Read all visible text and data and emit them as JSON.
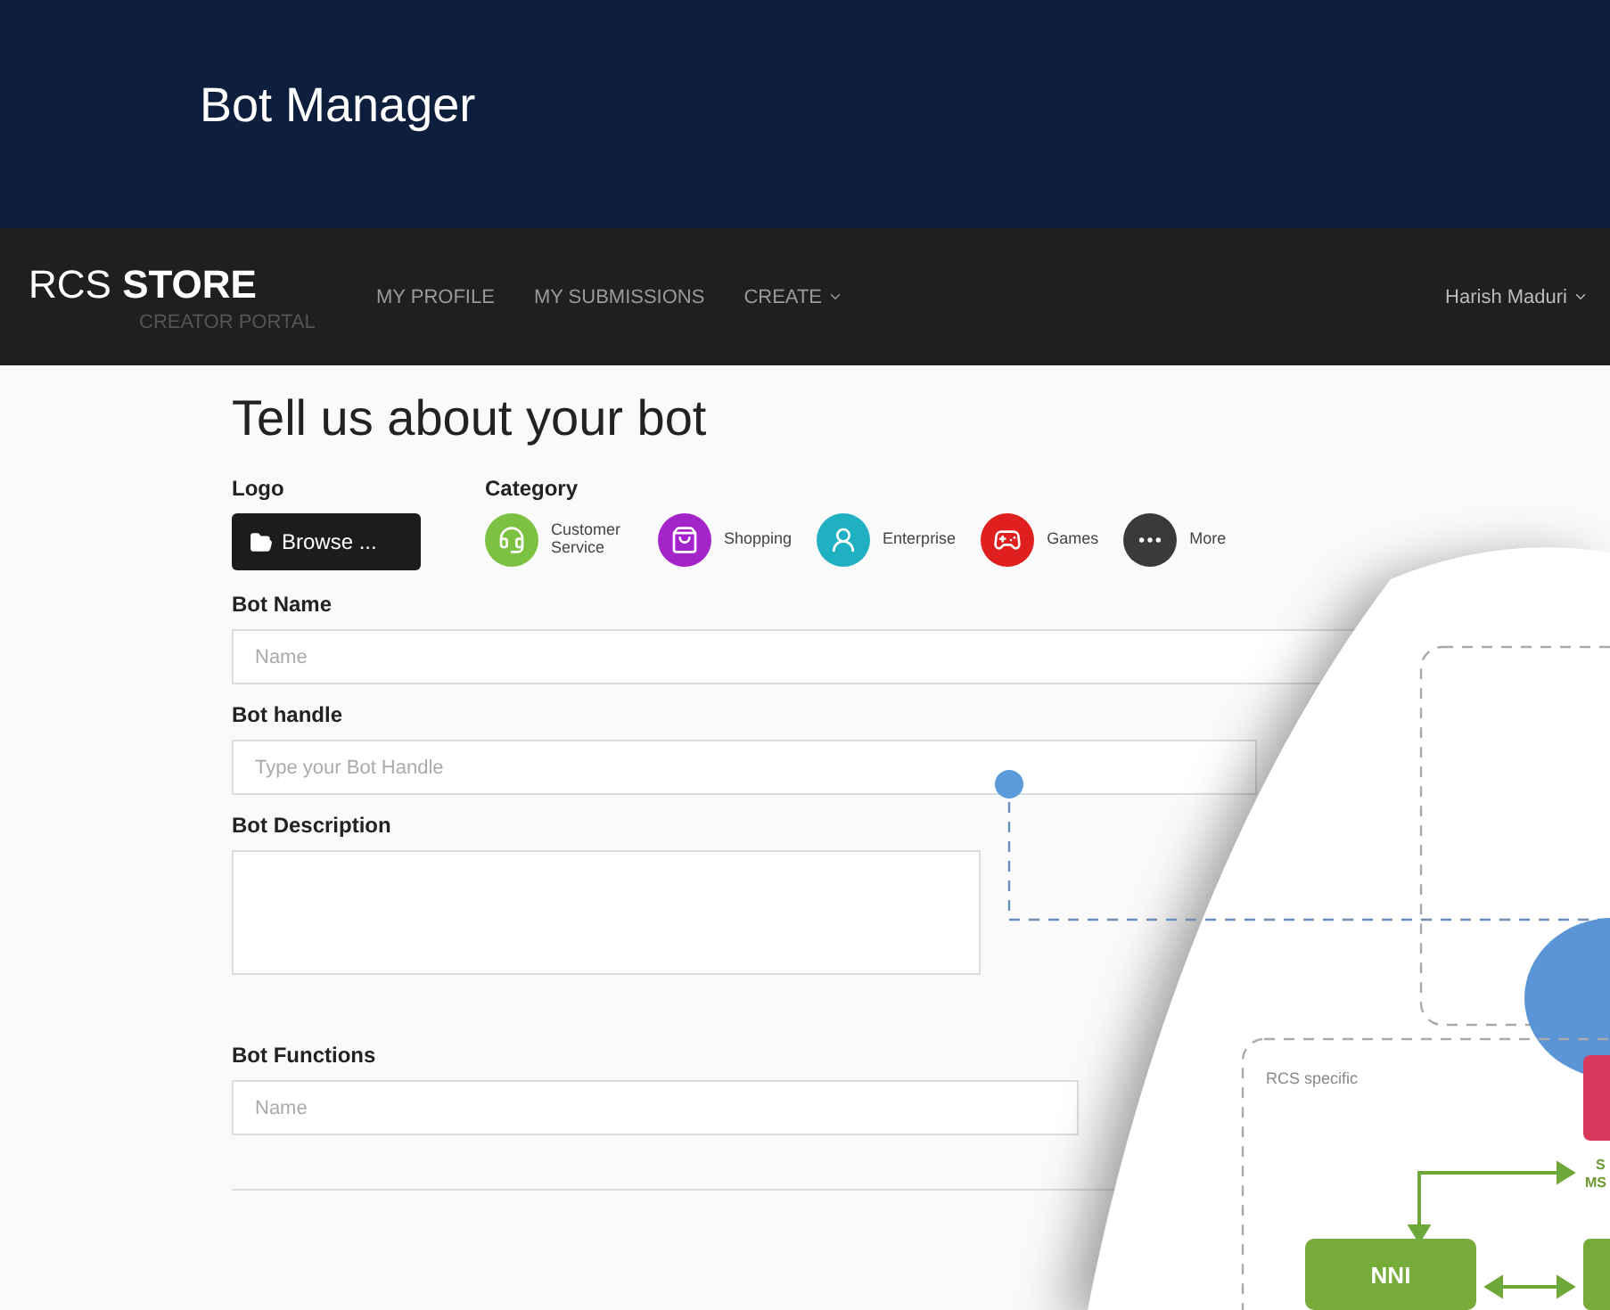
{
  "slide": {
    "title": "Bot Manager"
  },
  "navbar": {
    "brand": "RCS",
    "brand_bold": "STORE",
    "subtitle": "CREATOR PORTAL",
    "links": [
      {
        "label": "MY PROFILE",
        "dropdown": false
      },
      {
        "label": "MY SUBMISSIONS",
        "dropdown": false
      },
      {
        "label": "CREATE",
        "dropdown": true
      }
    ],
    "user": {
      "name": "Harish Maduri",
      "dropdown": true
    }
  },
  "form": {
    "heading": "Tell us about your bot",
    "logo_label": "Logo",
    "browse_button": "Browse ...",
    "category_label": "Category",
    "categories": [
      {
        "label": "Customer Service",
        "color": "#7dc142"
      },
      {
        "label": "Shopping",
        "color": "#a324c9"
      },
      {
        "label": "Enterprise",
        "color": "#1fb1c1"
      },
      {
        "label": "Games",
        "color": "#e0201e"
      },
      {
        "label": "More",
        "color": "#3a3a3a"
      }
    ],
    "fields": [
      {
        "label": "Bot Name",
        "placeholder": "Name",
        "kind": "input"
      },
      {
        "label": "Bot handle",
        "placeholder": "Type your Bot Handle",
        "kind": "input"
      },
      {
        "label": "Bot Description",
        "kind": "textarea"
      },
      {
        "label": "Bot Functions",
        "placeholder": "Name",
        "kind": "input"
      }
    ]
  },
  "diagram": {
    "group_label": "RCS specific",
    "node_label": "NNI",
    "cut_label_1": "S",
    "cut_label_2": "MS"
  }
}
